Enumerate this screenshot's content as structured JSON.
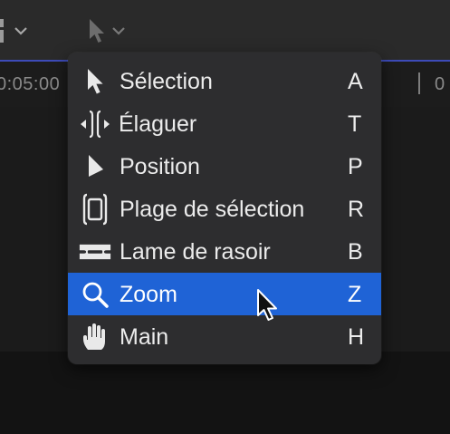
{
  "toolbar": {
    "tool_button_icon": "arrow-icon",
    "left_button_icon": "clip-icon",
    "dropdown_icon": "chevron-down-icon"
  },
  "timeline": {
    "timecode_left": "0:05:00",
    "timecode_right": "0"
  },
  "menu": {
    "items": [
      {
        "label": "Sélection",
        "shortcut": "A",
        "icon": "select-arrow-icon",
        "selected": false
      },
      {
        "label": "Élaguer",
        "shortcut": "T",
        "icon": "trim-icon",
        "selected": false
      },
      {
        "label": "Position",
        "shortcut": "P",
        "icon": "position-icon",
        "selected": false
      },
      {
        "label": "Plage de sélection",
        "shortcut": "R",
        "icon": "range-selection-icon",
        "selected": false
      },
      {
        "label": "Lame de rasoir",
        "shortcut": "B",
        "icon": "blade-icon",
        "selected": false
      },
      {
        "label": "Zoom",
        "shortcut": "Z",
        "icon": "zoom-magnifier-icon",
        "selected": true
      },
      {
        "label": "Main",
        "shortcut": "H",
        "icon": "hand-icon",
        "selected": false
      }
    ]
  },
  "colors": {
    "menu_background": "#2d2d2f",
    "highlight": "#1f63d6",
    "text": "#ececec"
  }
}
